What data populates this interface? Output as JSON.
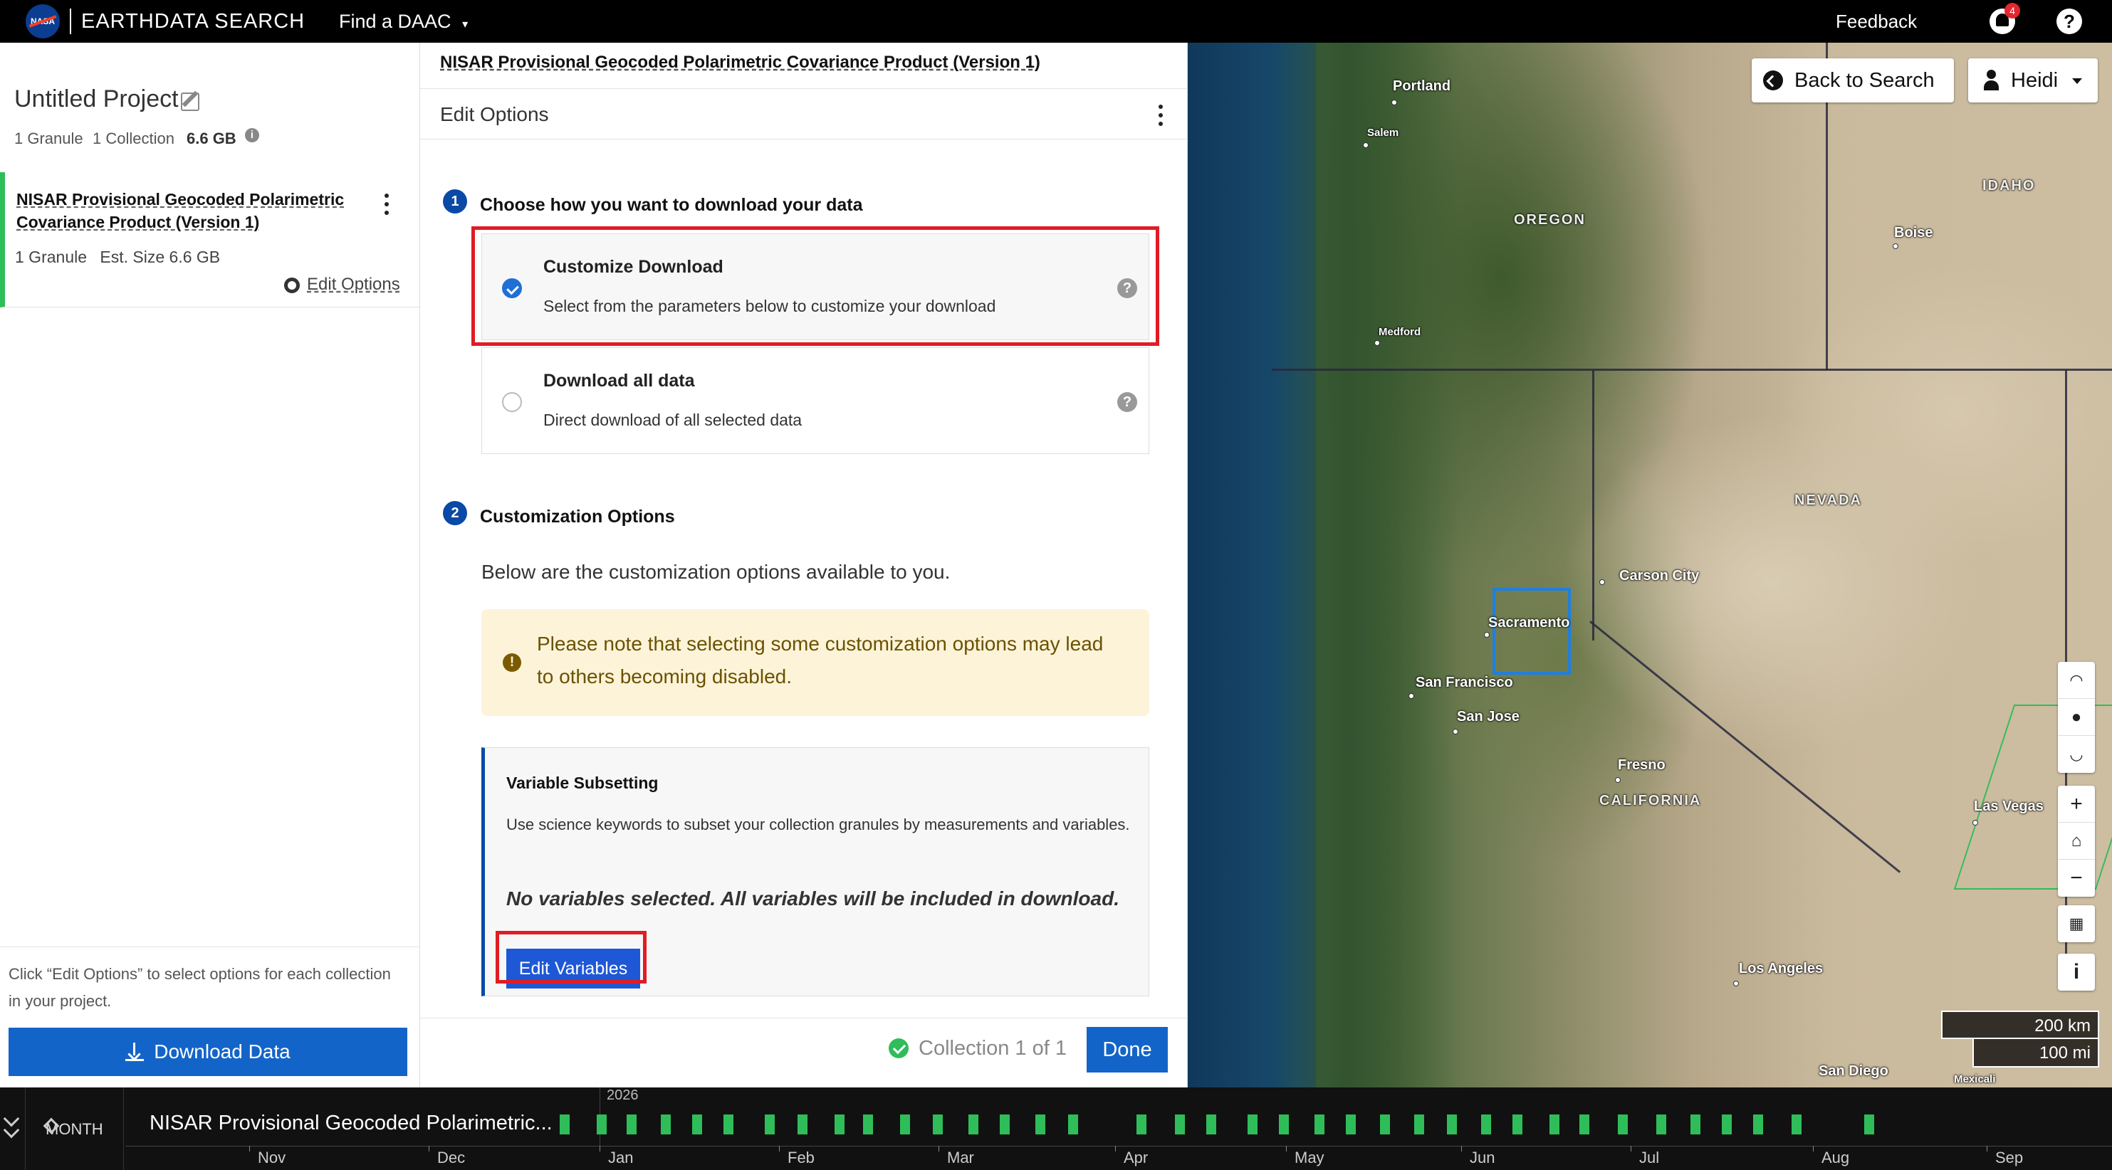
{
  "topnav": {
    "logo_text": "NASA",
    "app_title": "EARTHDATA SEARCH",
    "find_daac": "Find a DAAC",
    "feedback": "Feedback",
    "notification_count": "4",
    "help": "?"
  },
  "project": {
    "title": "Untitled Project",
    "granules": "1 Granule",
    "collections": "1 Collection",
    "size": "6.6 GB",
    "info": "i",
    "collection": {
      "name": "NISAR Provisional Geocoded Polarimetric Covariance Product (Version 1)",
      "granules": "1 Granule",
      "est_size": "Est. Size 6.6 GB",
      "edit_options": "Edit Options"
    },
    "footer_text": "Click “Edit Options” to select options for each collection in your project.",
    "download_button": "Download Data"
  },
  "panel": {
    "header": "NISAR Provisional Geocoded Polarimetric Covariance Product (Version 1)",
    "subheader": "Edit Options",
    "step1": {
      "num": "1",
      "title": "Choose how you want to download your data"
    },
    "options": [
      {
        "title": "Customize Download",
        "desc": "Select from the parameters below to customize your download",
        "selected": true
      },
      {
        "title": "Download all data",
        "desc": "Direct download of all selected data",
        "selected": false
      }
    ],
    "help_glyph": "?",
    "step2": {
      "num": "2",
      "title": "Customization Options"
    },
    "below_text": "Below are the customization options available to you.",
    "warning_glyph": "!",
    "warning": "Please note that selecting some customization options may lead to others becoming disabled.",
    "variable": {
      "title": "Variable Subsetting",
      "desc": "Use science keywords to subset your collection granules by measurements and variables.",
      "none_selected": "No variables selected. All variables will be included in download.",
      "button": "Edit Variables"
    },
    "footer": {
      "collection_of": "Collection 1 of 1",
      "done": "Done"
    }
  },
  "map": {
    "back_to_search": "Back to Search",
    "user": "Heidi",
    "states": [
      "OREGON",
      "IDAHO",
      "NEVADA",
      "CALIFORNIA"
    ],
    "cities": [
      "Portland",
      "Salem",
      "Medford",
      "Boise",
      "Carson City",
      "Sacramento",
      "San Francisco",
      "San Jose",
      "Fresno",
      "Las Vegas",
      "Los Angeles",
      "San Diego",
      "Mexicali"
    ],
    "controls": [
      "+",
      "−",
      "i"
    ],
    "scale": {
      "km": "200 km",
      "mi": "100 mi"
    },
    "colors": {
      "selection": "#1f7fe0",
      "granule": "#2fbd5a"
    }
  },
  "timeline": {
    "interval": "MONTH",
    "collection": "NISAR Provisional Geocoded Polarimetric...",
    "year": "2026",
    "months": [
      "Nov",
      "Dec",
      "Jan",
      "Feb",
      "Mar",
      "Apr",
      "May",
      "Jun",
      "Jul",
      "Aug",
      "Sep"
    ]
  },
  "colors": {
    "primary": "#1364c9",
    "active": "#2fbd5a",
    "highlight": "#e01c24",
    "warning_bg": "#fcf3d9"
  }
}
